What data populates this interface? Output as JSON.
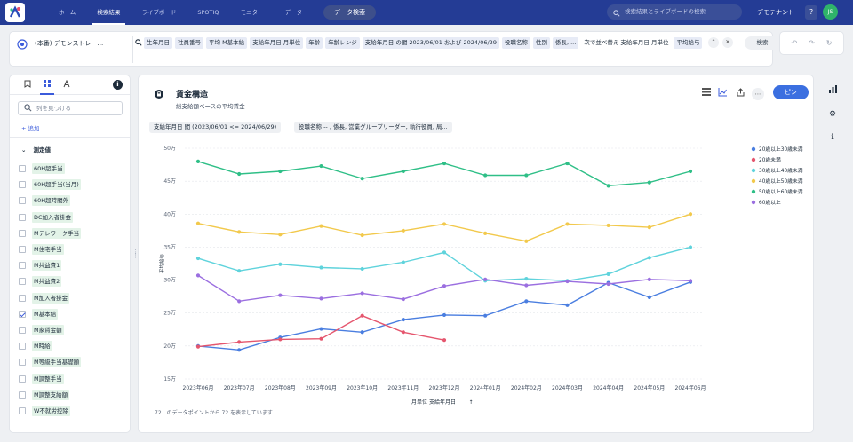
{
  "nav": {
    "tabs": [
      "ホーム",
      "検索結果",
      "ライブボード",
      "SPOTIQ",
      "モニター",
      "データ"
    ],
    "active_tab": 1,
    "data_search_label": "データ検索",
    "search_placeholder": "検索結果とライブボードの検索",
    "tenant": "デモテナント",
    "help": "?",
    "avatar": "JS"
  },
  "searchbar": {
    "workspace": "(本番) デモンストレー...",
    "tokens": [
      [
        "生年月日",
        true
      ],
      [
        "社員番号",
        true
      ],
      [
        "平均 M基本給",
        true
      ],
      [
        "支給年月日 月単位",
        true
      ],
      [
        "年齢",
        true
      ],
      [
        "年齢レンジ",
        true
      ],
      [
        "支給年月日 の間 2023/06/01 および 2024/06/29",
        true
      ],
      [
        "役職名称",
        true
      ],
      [
        "性別",
        true
      ],
      [
        "係長, ...",
        true
      ],
      [
        "次で並べ替え 支給年月日 月単位",
        false
      ],
      [
        "平均給与",
        true
      ]
    ],
    "search_button": "検索"
  },
  "left_panel": {
    "search_placeholder": "列を見つける",
    "add_label": "+ 追加",
    "section": "測定値",
    "items": [
      [
        "60H超手当",
        false
      ],
      [
        "60H超手当(当月)",
        false
      ],
      [
        "60H超時間外",
        false
      ],
      [
        "DC加入者掛金",
        false
      ],
      [
        "Mテレワーク手当",
        false
      ],
      [
        "M住宅手当",
        false
      ],
      [
        "M共益費1",
        false
      ],
      [
        "M共益費2",
        false
      ],
      [
        "M加入者掛金",
        false
      ],
      [
        "M基本給",
        true
      ],
      [
        "M家賃金額",
        false
      ],
      [
        "M時給",
        false
      ],
      [
        "M等級手当基礎額",
        false
      ],
      [
        "M調整手当",
        false
      ],
      [
        "M調整支給額",
        false
      ],
      [
        "W不就労控除",
        false
      ]
    ]
  },
  "chart_panel": {
    "title": "賃金構造",
    "subtitle": "総支給額ベースの平均賃金",
    "pin_label": "ピン",
    "filters": [
      "支給年月日 間 (2023/06/01 <= 2024/06/29)",
      "役職名称 -- , 係長, 営業グループリーダー, 執行役員, 局..."
    ],
    "footer": "72　のデータポイントから 72 を表示しています"
  },
  "chart_data": {
    "type": "line",
    "categories": [
      "2023年06月",
      "2023年07月",
      "2023年08月",
      "2023年09月",
      "2023年10月",
      "2023年11月",
      "2023年12月",
      "2024年01月",
      "2024年02月",
      "2024年03月",
      "2024年04月",
      "2024年05月",
      "2024年06月"
    ],
    "xlabel": "月単位 支給年月日",
    "ylabel": "平均給与",
    "yticks": [
      "15万",
      "20万",
      "25万",
      "30万",
      "35万",
      "40万",
      "45万",
      "50万"
    ],
    "ylim": [
      150000,
      500000
    ],
    "grid": true,
    "legend_position": "right",
    "series": [
      {
        "name": "20歳以上30歳未満",
        "color": "#4a7ee0",
        "values": [
          200000,
          194000,
          213000,
          226000,
          221000,
          240000,
          247000,
          246000,
          268000,
          262000,
          296000,
          274000,
          297000
        ]
      },
      {
        "name": "20歳未満",
        "color": "#e5566e",
        "values": [
          199000,
          206000,
          210000,
          211000,
          246000,
          221000,
          209000,
          null,
          null,
          null,
          null,
          null,
          null
        ]
      },
      {
        "name": "30歳以上40歳未満",
        "color": "#5fd3dc",
        "values": [
          333000,
          314000,
          324000,
          319000,
          317000,
          327000,
          342000,
          299000,
          302000,
          299000,
          309000,
          334000,
          350000
        ]
      },
      {
        "name": "40歳以上50歳未満",
        "color": "#f2c94c",
        "values": [
          386000,
          373000,
          369000,
          382000,
          368000,
          375000,
          385000,
          371000,
          359000,
          385000,
          383000,
          380000,
          400000
        ]
      },
      {
        "name": "50歳以上60歳未満",
        "color": "#2fbf87",
        "values": [
          480000,
          461000,
          465000,
          473000,
          454000,
          465000,
          477000,
          459000,
          459000,
          477000,
          443000,
          448000,
          465000
        ]
      },
      {
        "name": "60歳以上",
        "color": "#9b6fe0",
        "values": [
          307000,
          268000,
          277000,
          272000,
          280000,
          271000,
          291000,
          301000,
          292000,
          298000,
          294000,
          301000,
          299000
        ]
      }
    ]
  }
}
